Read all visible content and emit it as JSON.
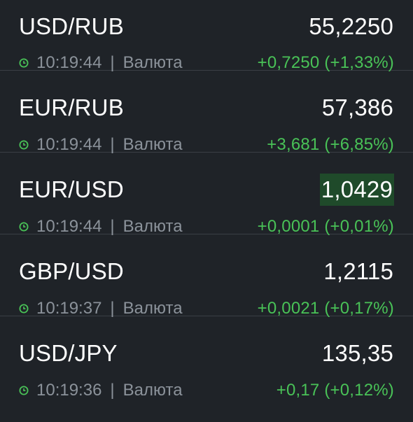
{
  "rows": [
    {
      "pair": "USD/RUB",
      "price": "55,2250",
      "time": "10:19:44",
      "type": "Валюта",
      "change": "+0,7250 (+1,33%)"
    },
    {
      "pair": "EUR/RUB",
      "price": "57,386",
      "time": "10:19:44",
      "type": "Валюта",
      "change": "+3,681 (+6,85%)"
    },
    {
      "pair": "EUR/USD",
      "price": "1,0429",
      "time": "10:19:44",
      "type": "Валюта",
      "change": "+0,0001 (+0,01%)"
    },
    {
      "pair": "GBP/USD",
      "price": "1,2115",
      "time": "10:19:37",
      "type": "Валюта",
      "change": "+0,0021 (+0,17%)"
    },
    {
      "pair": "USD/JPY",
      "price": "135,35",
      "time": "10:19:36",
      "type": "Валюта",
      "change": "+0,17 (+0,12%)"
    }
  ],
  "separator": "|",
  "colors": {
    "background": "#1f2328",
    "positive": "#49c257",
    "muted": "#8b929a",
    "flash_highlight": "#1f4a2a"
  },
  "icons": {
    "time": "clock-icon"
  }
}
